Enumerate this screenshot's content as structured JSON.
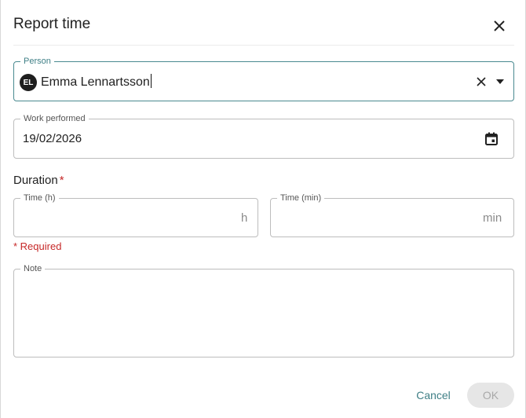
{
  "dialog": {
    "title": "Report time",
    "person": {
      "label": "Person",
      "initials": "EL",
      "value": "Emma Lennartsson"
    },
    "work_performed": {
      "label": "Work performed",
      "value": "19/02/2026"
    },
    "duration": {
      "label": "Duration",
      "required_mark": "*",
      "hours": {
        "label": "Time (h)",
        "value": "",
        "suffix": "h"
      },
      "minutes": {
        "label": "Time (min)",
        "value": "",
        "suffix": "min"
      },
      "error": "* Required"
    },
    "note": {
      "label": "Note",
      "value": ""
    },
    "actions": {
      "cancel": "Cancel",
      "ok": "OK"
    }
  },
  "colors": {
    "accent": "#3f7f86",
    "error": "#c62828",
    "disabled_bg": "#e6e6e6"
  }
}
